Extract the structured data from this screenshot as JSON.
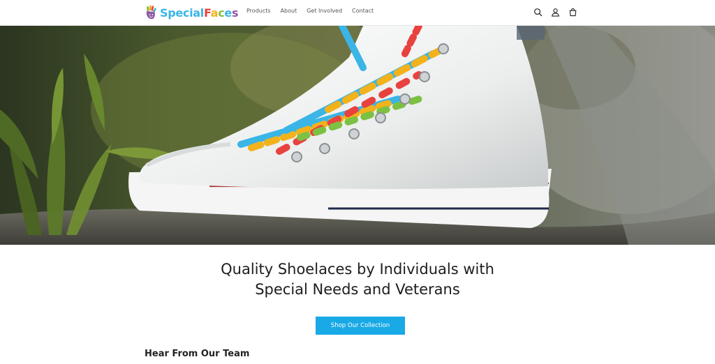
{
  "header": {
    "logo": {
      "part1": "Special",
      "part2_letters": [
        "F",
        "a",
        "c",
        "e",
        "s"
      ]
    },
    "nav": [
      {
        "label": "Products"
      },
      {
        "label": "About"
      },
      {
        "label": "Get Involved"
      },
      {
        "label": "Contact"
      }
    ],
    "icons": [
      "search-icon",
      "account-icon",
      "cart-icon"
    ]
  },
  "hero": {
    "image": "white high-top sneaker with colorful puzzle-pattern shoelaces on a rock outdoors"
  },
  "main": {
    "headline_line1": "Quality Shoelaces by Individuals with",
    "headline_line2": "Special Needs and Veterans",
    "cta_label": "Shop Our Collection",
    "section_title": "Hear From Our Team"
  },
  "colors": {
    "accent": "#19a9e6",
    "logo_blue": "#3ab5e6",
    "logo_red": "#e8423f",
    "logo_yellow": "#f2b21b",
    "logo_green": "#7dc142",
    "logo_purple": "#8e59a6"
  }
}
